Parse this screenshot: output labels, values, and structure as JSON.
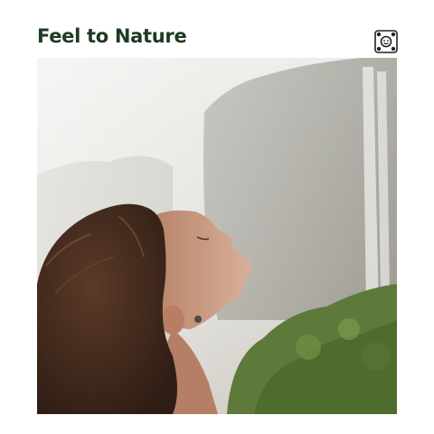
{
  "cover": {
    "title": "Feel to Nature",
    "photo_subject": "woman-face-looking-up-near-waterfall",
    "logo_icon": "record-label-emblem-icon"
  },
  "colors": {
    "title": "#1f3a22",
    "background": "#ffffff",
    "sky": "#e8e8e4",
    "foliage": "#5d7a3a",
    "hair": "#4a2f22",
    "skin": "#c99a7e"
  }
}
